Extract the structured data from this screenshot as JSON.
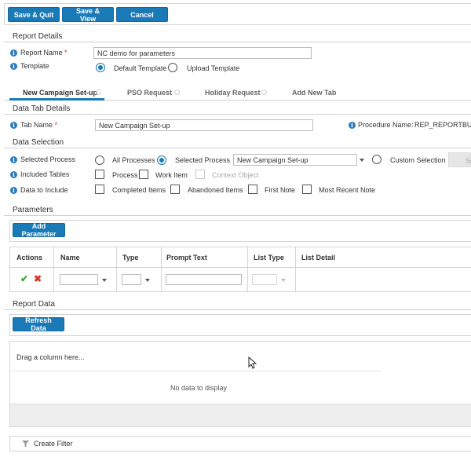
{
  "toolbar": {
    "save_quit": "Save & Quit",
    "save_view": "Save & View",
    "cancel": "Cancel"
  },
  "report_details": {
    "title": "Report Details",
    "report_name_label": "Report Name",
    "required_mark": "*",
    "report_name_value": "NC demo for parameters",
    "template_label": "Template",
    "default_template": "Default Template",
    "upload_template": "Upload Template",
    "selected_template": "Default Template"
  },
  "tabs": [
    {
      "label": "New Campaign Set-up",
      "active": true
    },
    {
      "label": "PSO Request",
      "active": false
    },
    {
      "label": "Holiday Request",
      "active": false
    },
    {
      "label": "Add New Tab",
      "active": false
    }
  ],
  "data_tab_details": {
    "title": "Data Tab Details",
    "tab_name_label": "Tab Name",
    "required_mark": "*",
    "tab_name_value": "New Campaign Set-up",
    "procedure_label": "Procedure Name:",
    "procedure_value": "REP_REPORTBUIL"
  },
  "data_selection": {
    "title": "Data Selection",
    "selected_process_label": "Selected Process",
    "all_processes": "All Processes",
    "selected_process_option": "Selected Process",
    "process_dropdown_value": "New Campaign Set-up",
    "custom_selection": "Custom Selection",
    "select_button": "Se",
    "included_tables_label": "Included Tables",
    "tables": [
      "Process",
      "Work Item",
      "Context Object"
    ],
    "data_to_include_label": "Data to Include",
    "include_items": [
      "Completed Items",
      "Abandoned Items",
      "First Note",
      "Most Recent Note"
    ]
  },
  "parameters": {
    "title": "Parameters",
    "add_button": "Add Parameter",
    "columns": [
      "Actions",
      "Name",
      "Type",
      "Prompt Text",
      "List Type",
      "List Detail"
    ]
  },
  "report_data": {
    "title": "Report Data",
    "refresh_button": "Refresh Data",
    "drag_hint": "Drag a column here...",
    "no_data": "No data to display",
    "create_filter": "Create Filter"
  },
  "colors": {
    "accent": "#1a7ab8",
    "info_icon": "#2a7bbf",
    "check_green": "#3aa935",
    "delete_red": "#d03a2b"
  }
}
